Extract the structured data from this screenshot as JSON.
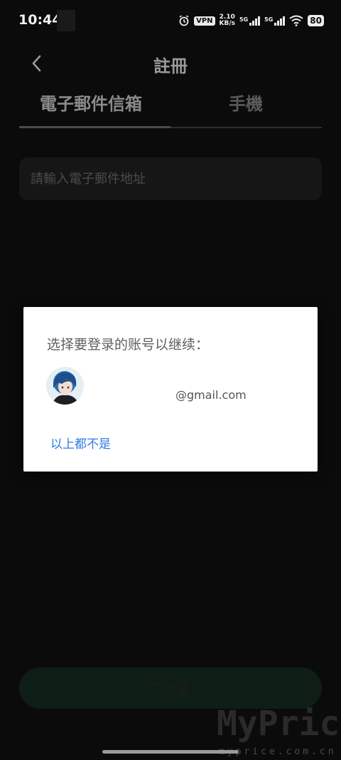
{
  "status_bar": {
    "time": "10:44",
    "vpn": "VPN",
    "speed_value": "2.10",
    "speed_unit": "KB/s",
    "net1": "5G",
    "net2": "5G",
    "battery": "80"
  },
  "header": {
    "title": "註冊",
    "back_icon": "chevron-left-icon"
  },
  "tabs": [
    {
      "label": "電子郵件信箱",
      "active": true
    },
    {
      "label": "手機",
      "active": false
    }
  ],
  "email_field": {
    "placeholder": "請輸入電子郵件地址",
    "value": ""
  },
  "next_button": {
    "label": "下一張"
  },
  "dialog": {
    "title": "选择要登录的账号以继续：",
    "account_email": "@gmail.com",
    "none_above": "以上都不是"
  },
  "watermark": {
    "big": "MyPrice",
    "small": "myprice.com.cn"
  },
  "colors": {
    "background": "#0b0b0b",
    "dialog_bg": "#ffffff",
    "link_blue": "#2f7ae5",
    "next_button_bg": "#0e1e17"
  }
}
